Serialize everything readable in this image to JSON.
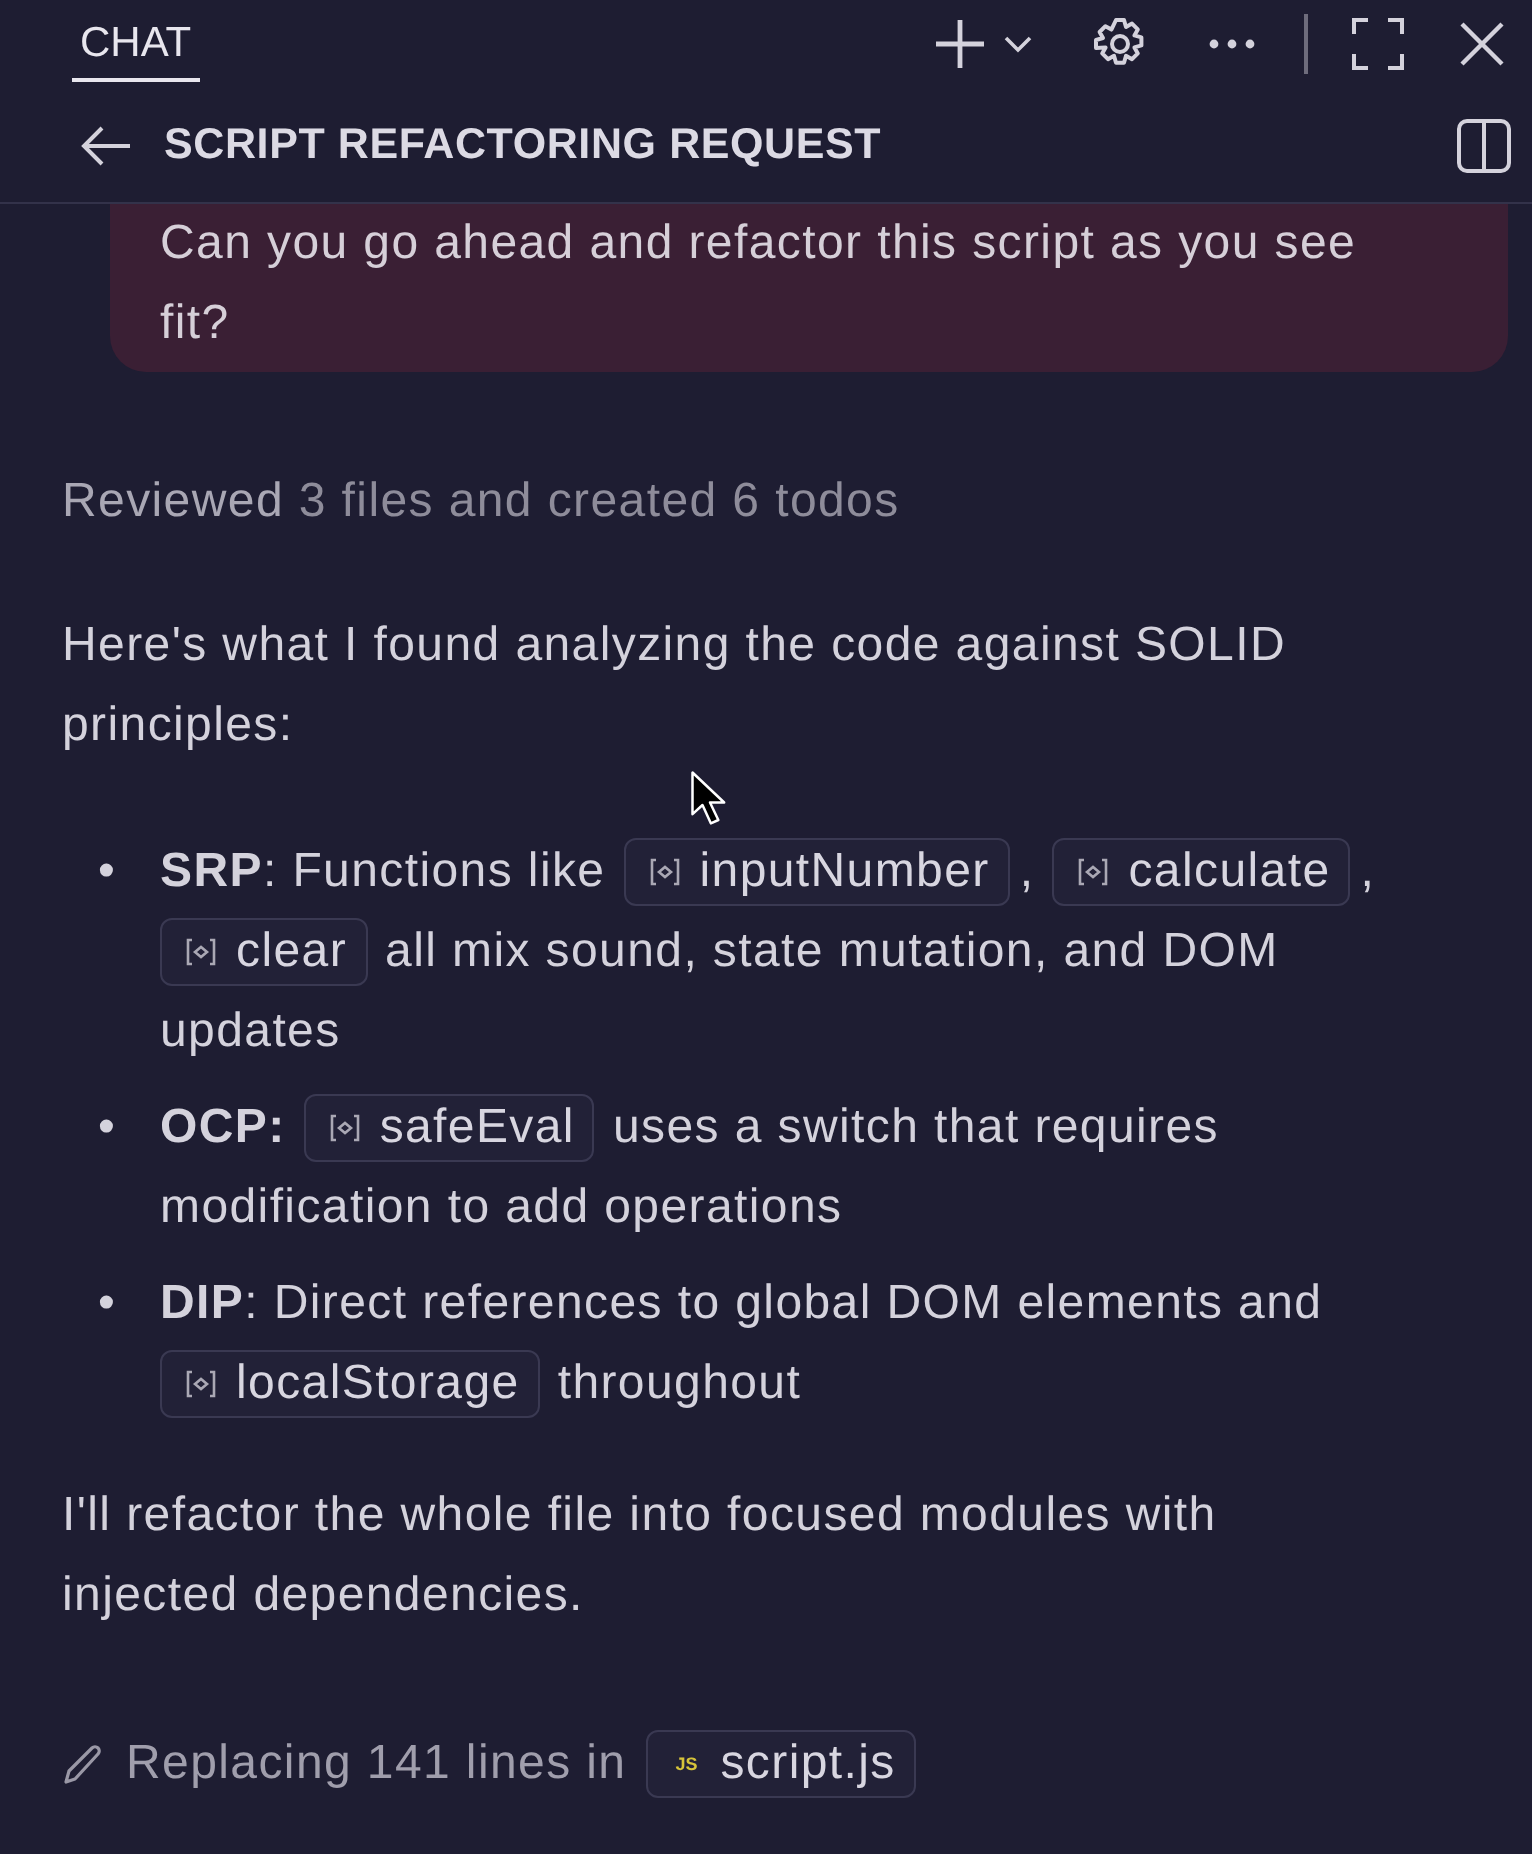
{
  "tabs": [
    {
      "label": "CHAT",
      "selected": true
    }
  ],
  "thread": {
    "title": "SCRIPT REFACTORING REQUEST"
  },
  "user_message": "Can you go ahead and refactor this script as you see fit?",
  "progress": {
    "verb": "Reviewed",
    "detail": "3 files and created 6 todos"
  },
  "intro": "Here's what I found analyzing the code against SOLID principles:",
  "bullets": [
    {
      "marker": "•",
      "lines": [
        [
          {
            "kind": "text",
            "text": "**SRP**: Functions like"
          },
          {
            "kind": "code",
            "text": "inputNumber"
          },
          {
            "kind": "text",
            "text": ","
          },
          {
            "kind": "code",
            "text": "calculate"
          },
          {
            "kind": "text",
            "text": ","
          }
        ],
        [
          {
            "kind": "code",
            "text": "clear"
          },
          {
            "kind": "text",
            "text": "all mix sound, state mutation, and DOM"
          }
        ],
        [
          {
            "kind": "text",
            "text": "updates"
          }
        ]
      ]
    },
    {
      "marker": "•",
      "lines": [
        [
          {
            "kind": "text",
            "text": "**OCP:**"
          },
          {
            "kind": "code",
            "text": "safeEval"
          },
          {
            "kind": "text",
            "text": "uses a switch that requires"
          }
        ],
        [
          {
            "kind": "text",
            "text": "modification to add operations"
          }
        ]
      ]
    },
    {
      "marker": "•",
      "lines": [
        [
          {
            "kind": "text",
            "text": "**DIP**: Direct references to global DOM elements and"
          }
        ],
        [
          {
            "kind": "code",
            "text": "localStorage"
          },
          {
            "kind": "text",
            "text": "throughout"
          }
        ]
      ]
    }
  ],
  "conclusion": "I'll refactor the whole file into focused modules with injected dependencies.",
  "edit": {
    "text": "Replacing 141 lines in",
    "file": "script.js",
    "file_badge": "JS"
  }
}
